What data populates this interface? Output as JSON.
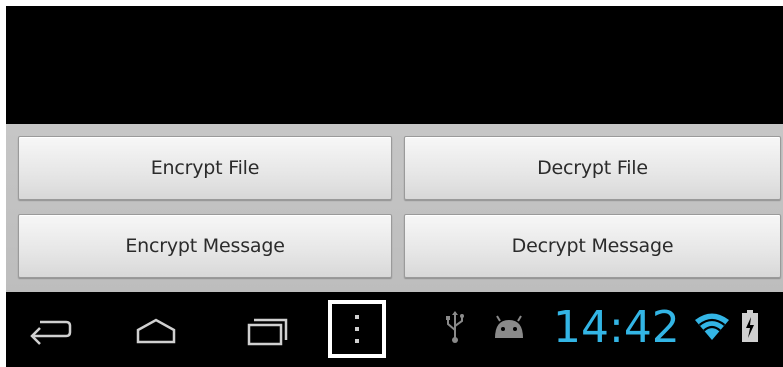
{
  "buttons": {
    "encrypt_file": "Encrypt File",
    "decrypt_file": "Decrypt File",
    "encrypt_message": "Encrypt Message",
    "decrypt_message": "Decrypt Message"
  },
  "status_bar": {
    "time": "14:42",
    "time_color": "#33b5e5"
  },
  "nav_icons": [
    "back-icon",
    "home-icon",
    "recent-apps-icon",
    "overflow-menu-icon"
  ],
  "status_icons": [
    "usb-icon",
    "android-debug-icon",
    "wifi-icon",
    "battery-charging-icon"
  ]
}
